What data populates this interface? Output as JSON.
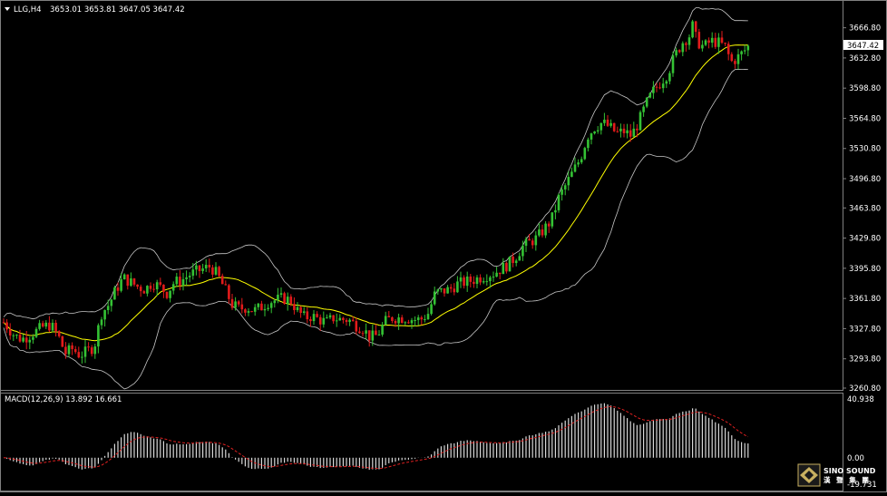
{
  "header": {
    "symbol_label": "LLG,H4",
    "ohlc_label": "3653.01 3653.81 3647.05 3647.42"
  },
  "macd_header": {
    "label": "MACD(12,26,9) 13.892 16.661"
  },
  "price_axis": {
    "ticks": [
      "3666.80",
      "3632.80",
      "3598.80",
      "3564.80",
      "3530.80",
      "3496.80",
      "3463.80",
      "3429.80",
      "3395.80",
      "3361.80",
      "3327.80",
      "3293.80",
      "3260.80"
    ],
    "current_price_tag": "3647.42"
  },
  "macd_axis": {
    "top": "40.938",
    "zero": "0.00",
    "bottom": "-19.731"
  },
  "logo": {
    "text": "SINO SOUND",
    "subtext": "漢 聲 集 團"
  },
  "colors": {
    "background": "#000000",
    "bull_candle": "#34c234",
    "bear_candle": "#e21b1b",
    "bollinger": "#c8c8c8",
    "ma_line": "#ffff00",
    "macd_hist": "#d8d8d8",
    "macd_signal": "#e02020",
    "price_tag_bg": "#ffffff",
    "price_tag_fg": "#000000"
  },
  "chart_data": [
    {
      "type": "candlestick",
      "symbol": "LLG",
      "timeframe": "H4",
      "ylim": [
        3260.8,
        3683.8
      ],
      "indicators": [
        "Bollinger Bands",
        "Moving Average"
      ],
      "close_path": [
        [
          0,
          3340
        ],
        [
          8,
          3330
        ],
        [
          16,
          3320
        ],
        [
          24,
          3316
        ],
        [
          32,
          3320
        ],
        [
          40,
          3325
        ],
        [
          48,
          3330
        ],
        [
          56,
          3332
        ],
        [
          64,
          3320
        ],
        [
          72,
          3300
        ],
        [
          80,
          3305
        ],
        [
          88,
          3298
        ],
        [
          96,
          3302
        ],
        [
          104,
          3308
        ],
        [
          112,
          3345
        ],
        [
          120,
          3355
        ],
        [
          128,
          3372
        ],
        [
          136,
          3385
        ],
        [
          144,
          3380
        ],
        [
          152,
          3375
        ],
        [
          160,
          3372
        ],
        [
          168,
          3380
        ],
        [
          176,
          3375
        ],
        [
          184,
          3368
        ],
        [
          192,
          3380
        ],
        [
          200,
          3382
        ],
        [
          208,
          3388
        ],
        [
          216,
          3392
        ],
        [
          224,
          3395
        ],
        [
          232,
          3398
        ],
        [
          240,
          3388
        ],
        [
          248,
          3372
        ],
        [
          256,
          3355
        ],
        [
          264,
          3350
        ],
        [
          272,
          3352
        ],
        [
          280,
          3348
        ],
        [
          288,
          3352
        ],
        [
          296,
          3358
        ],
        [
          304,
          3360
        ],
        [
          312,
          3362
        ],
        [
          320,
          3360
        ],
        [
          328,
          3348
        ],
        [
          336,
          3340
        ],
        [
          344,
          3342
        ],
        [
          352,
          3338
        ],
        [
          360,
          3335
        ],
        [
          368,
          3340
        ],
        [
          376,
          3338
        ],
        [
          384,
          3338
        ],
        [
          392,
          3332
        ],
        [
          400,
          3328
        ],
        [
          408,
          3318
        ],
        [
          416,
          3320
        ],
        [
          424,
          3335
        ],
        [
          432,
          3340
        ],
        [
          440,
          3340
        ],
        [
          448,
          3340
        ],
        [
          456,
          3338
        ],
        [
          464,
          3338
        ],
        [
          472,
          3345
        ],
        [
          480,
          3368
        ],
        [
          488,
          3370
        ],
        [
          496,
          3372
        ],
        [
          504,
          3378
        ],
        [
          512,
          3380
        ],
        [
          520,
          3382
        ],
        [
          528,
          3385
        ],
        [
          536,
          3388
        ],
        [
          544,
          3390
        ],
        [
          552,
          3395
        ],
        [
          560,
          3400
        ],
        [
          568,
          3408
        ],
        [
          576,
          3420
        ],
        [
          584,
          3425
        ],
        [
          592,
          3430
        ],
        [
          600,
          3440
        ],
        [
          608,
          3450
        ],
        [
          616,
          3475
        ],
        [
          624,
          3490
        ],
        [
          632,
          3505
        ],
        [
          640,
          3520
        ],
        [
          648,
          3545
        ],
        [
          656,
          3555
        ],
        [
          664,
          3560
        ],
        [
          672,
          3555
        ],
        [
          680,
          3548
        ],
        [
          688,
          3550
        ],
        [
          696,
          3545
        ],
        [
          704,
          3560
        ],
        [
          712,
          3580
        ],
        [
          720,
          3595
        ],
        [
          728,
          3605
        ],
        [
          736,
          3615
        ],
        [
          744,
          3635
        ],
        [
          752,
          3650
        ],
        [
          760,
          3658
        ],
        [
          764,
          3670
        ],
        [
          768,
          3652
        ],
        [
          776,
          3645
        ],
        [
          784,
          3652
        ],
        [
          792,
          3650
        ],
        [
          800,
          3645
        ],
        [
          806,
          3628
        ],
        [
          812,
          3632
        ],
        [
          820,
          3640
        ],
        [
          826,
          3647
        ]
      ]
    },
    {
      "type": "bar",
      "name": "MACD(12,26,9)",
      "ylim": [
        -19.731,
        40.938
      ],
      "last_macd": 13.892,
      "last_signal": 16.661
    }
  ]
}
